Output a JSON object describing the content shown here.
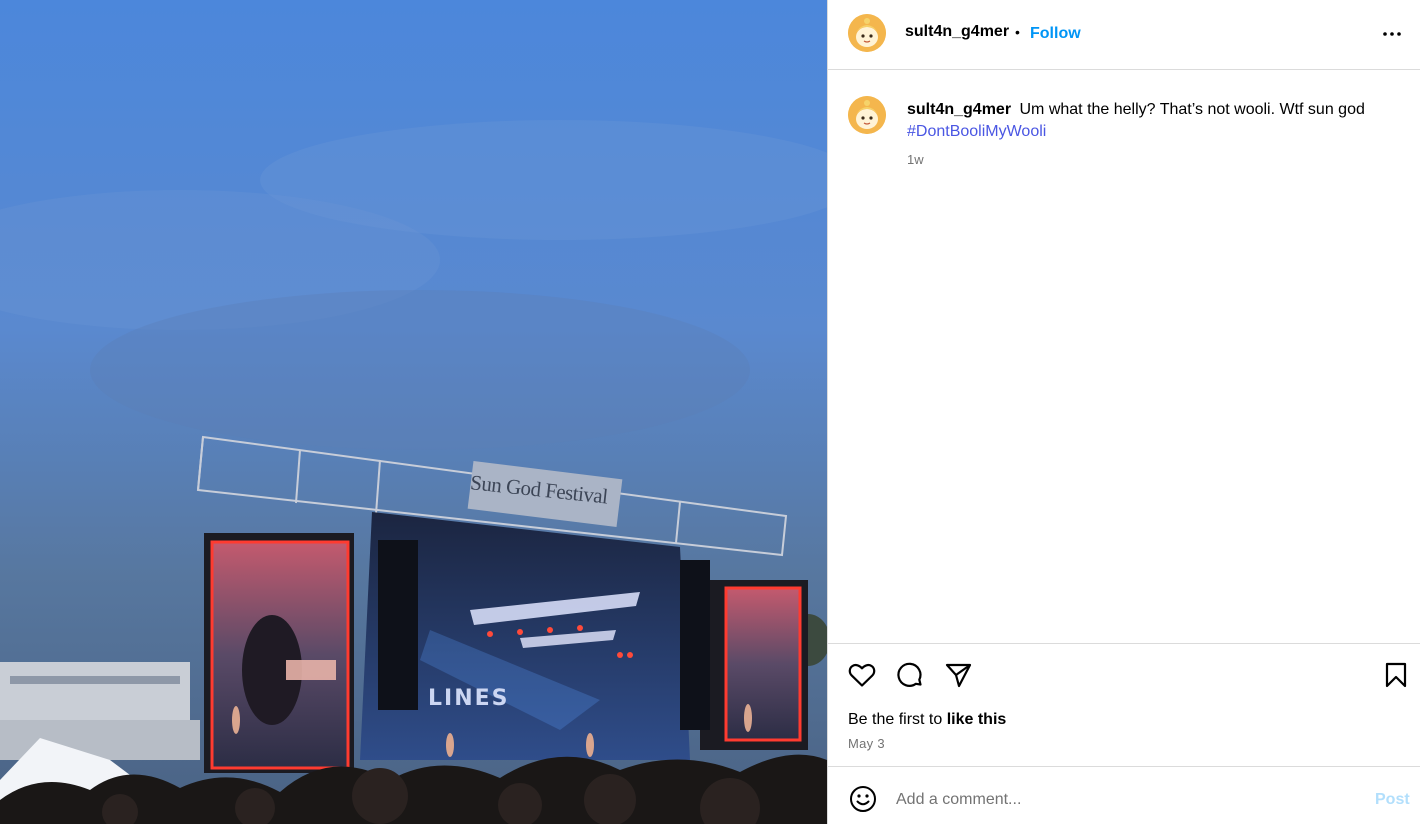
{
  "photo": {
    "alt_banner_text": "Sun God Festival",
    "screen_text": "LINES"
  },
  "header": {
    "username": "sult4n_g4mer",
    "separator": "•",
    "follow_label": "Follow",
    "more_icon": "more-horizontal-icon"
  },
  "caption": {
    "username": "sult4n_g4mer",
    "text": "Um what the helly? That’s not wooli. Wtf sun god",
    "hashtag": "#DontBooliMyWooli",
    "time_ago": "1w"
  },
  "actions": {
    "icons": [
      "heart-icon",
      "comment-icon",
      "share-icon",
      "bookmark-icon"
    ],
    "like_prefix": "Be the first to",
    "like_action": "like this",
    "date": "May 3"
  },
  "comment": {
    "emoji_icon": "emoji-icon",
    "placeholder": "Add a comment...",
    "post_label": "Post"
  },
  "colors": {
    "accent": "#0095f6",
    "hashtag": "#4a56e3",
    "muted": "#737373",
    "post_disabled": "#b2dffc"
  }
}
